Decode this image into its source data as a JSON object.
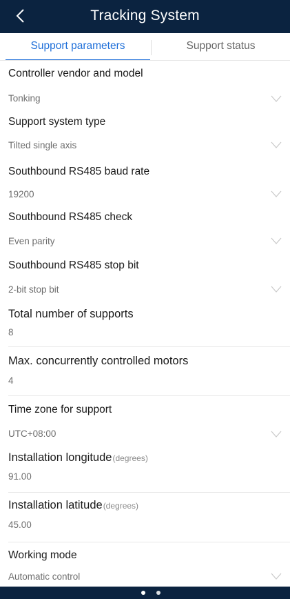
{
  "header": {
    "title": "Tracking System",
    "back_icon": "chevron-left-icon"
  },
  "tabs": [
    {
      "label": "Support parameters",
      "active": true
    },
    {
      "label": "Support status",
      "active": false
    }
  ],
  "fields": [
    {
      "label": "Controller vendor and model",
      "unit": "",
      "value": "Tonking",
      "dropdown": true
    },
    {
      "label": "Support system type",
      "unit": "",
      "value": "Tilted single axis",
      "dropdown": true
    },
    {
      "label": "Southbound RS485 baud rate",
      "unit": "",
      "value": "19200",
      "dropdown": true
    },
    {
      "label": "Southbound RS485 check",
      "unit": "",
      "value": "Even parity",
      "dropdown": true
    },
    {
      "label": "Southbound RS485 stop bit",
      "unit": "",
      "value": "2-bit stop bit",
      "dropdown": true
    },
    {
      "label": "Total number of supports",
      "unit": "",
      "value": "8",
      "dropdown": false
    },
    {
      "label": "Max. concurrently controlled motors",
      "unit": "",
      "value": "4",
      "dropdown": false
    },
    {
      "label": "Time zone for support",
      "unit": "",
      "value": "UTC+08:00",
      "dropdown": true
    },
    {
      "label": "Installation longitude",
      "unit": "(degrees)",
      "value": "91.00",
      "dropdown": false
    },
    {
      "label": "Installation latitude",
      "unit": "(degrees)",
      "value": "45.00",
      "dropdown": false
    },
    {
      "label": "Working mode",
      "unit": "",
      "value": "Automatic control",
      "dropdown": true
    }
  ],
  "pager": {
    "count": 2
  },
  "colors": {
    "header_bg": "#0b2340",
    "accent": "#1e6fd9"
  }
}
